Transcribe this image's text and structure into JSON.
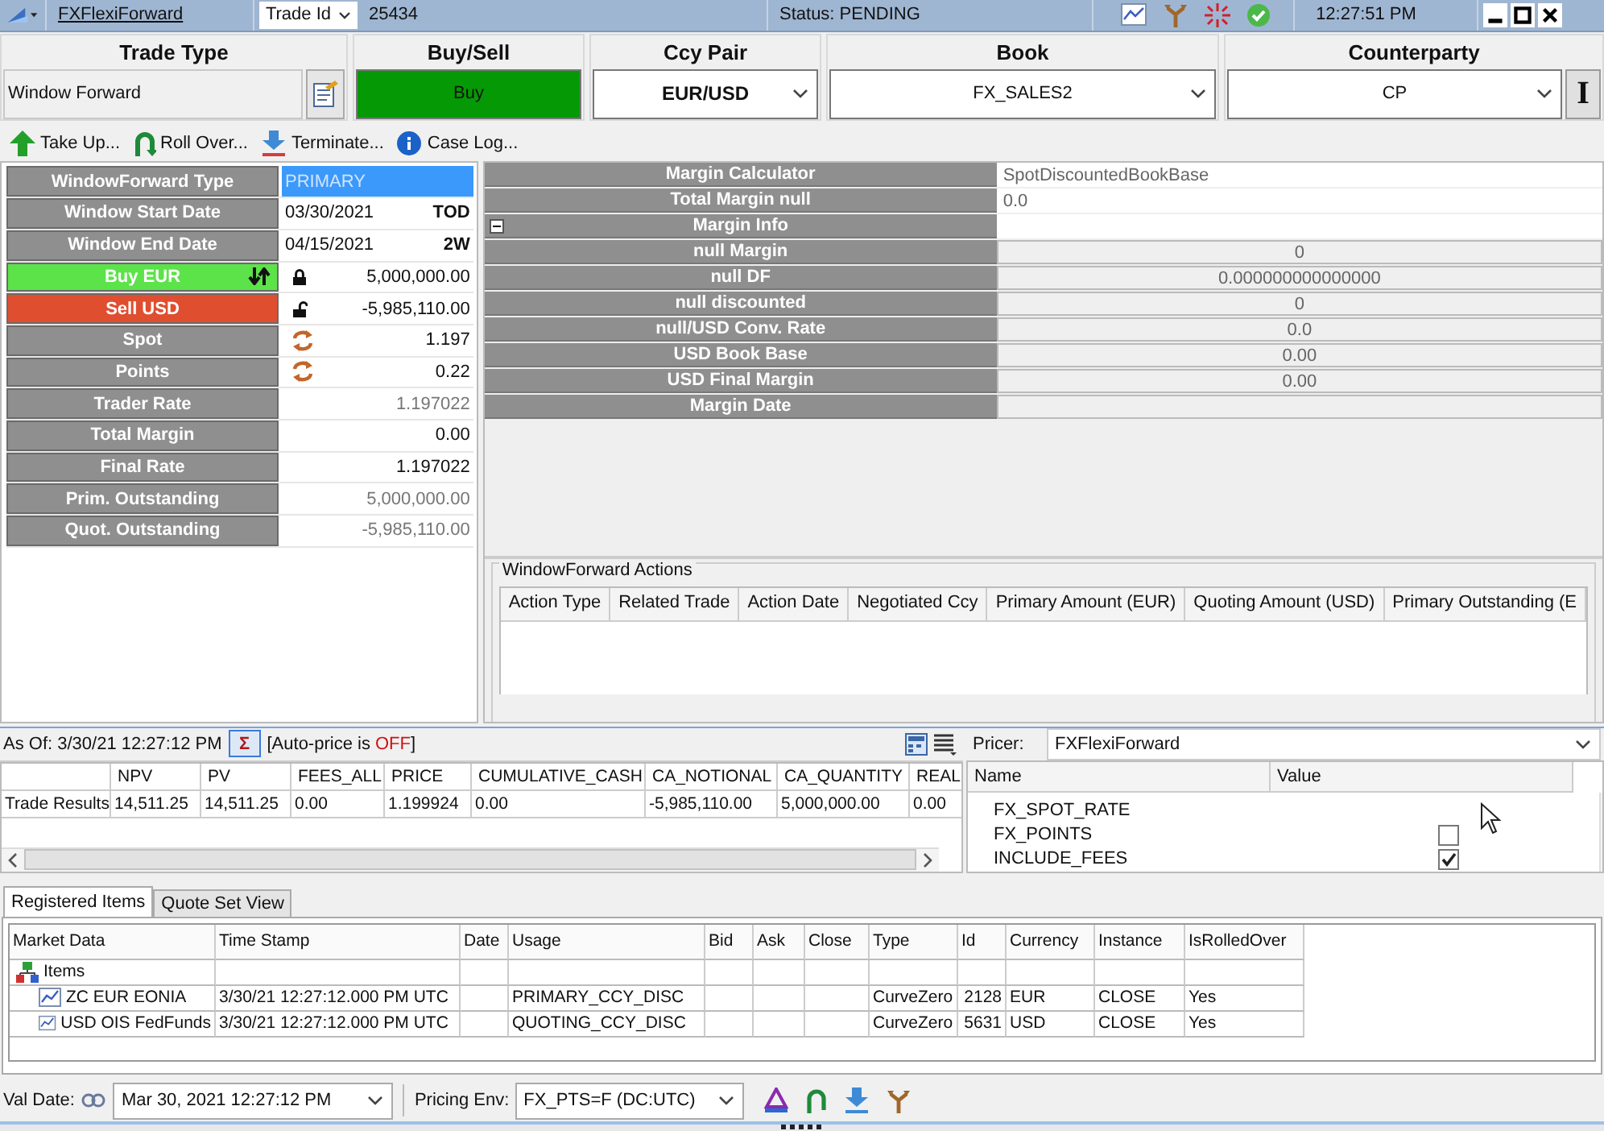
{
  "title_bar": {
    "trade_link": "FXFlexiForward",
    "id_selector": "Trade Id",
    "trade_id": "25434",
    "status": "Status: PENDING",
    "time": "12:27:51 PM"
  },
  "header_fields": [
    {
      "kind": "text",
      "label": "Trade Type",
      "value": "Window Forward"
    },
    {
      "kind": "buy",
      "label": "Buy/Sell",
      "value": "Buy"
    },
    {
      "kind": "select",
      "label": "Ccy Pair",
      "value": "EUR/USD"
    },
    {
      "kind": "select",
      "label": "Book",
      "value": "FX_SALES2"
    },
    {
      "kind": "select_button",
      "label": "Counterparty",
      "value": "CP",
      "button": "I"
    }
  ],
  "actions": [
    {
      "kind": "up",
      "label": "Take Up..."
    },
    {
      "kind": "roll",
      "label": "Roll Over..."
    },
    {
      "kind": "terminate",
      "label": "Terminate..."
    },
    {
      "kind": "info",
      "label": "Case Log..."
    }
  ],
  "trade_fields": [
    {
      "kind": "type",
      "label": "WindowForward Type",
      "value": "PRIMARY",
      "disabled": true
    },
    {
      "kind": "date",
      "label": "Window Start Date",
      "value": "03/30/2021",
      "tenor": "TOD",
      "disabled": false
    },
    {
      "kind": "date",
      "label": "Window End Date",
      "value": "04/15/2021",
      "tenor": "2W",
      "disabled": false
    },
    {
      "kind": "buy",
      "label": "Buy EUR",
      "value": "5,000,000.00",
      "locked": true,
      "disabled": false
    },
    {
      "kind": "sell",
      "label": "Sell USD",
      "value": "-5,985,110.00",
      "locked": false,
      "disabled": false
    },
    {
      "kind": "refresh",
      "label": "Spot",
      "value": "1.197",
      "disabled": false
    },
    {
      "kind": "refresh",
      "label": "Points",
      "value": "0.22",
      "disabled": false
    },
    {
      "kind": "plain",
      "label": "Trader Rate",
      "value": "1.197022",
      "disabled": true
    },
    {
      "kind": "plain",
      "label": "Total Margin",
      "value": "0.00",
      "disabled": false
    },
    {
      "kind": "plain",
      "label": "Final Rate",
      "value": "1.197022",
      "disabled": false
    },
    {
      "kind": "plain",
      "label": "Prim. Outstanding",
      "value": "5,000,000.00",
      "disabled": true
    },
    {
      "kind": "plain",
      "label": "Quot. Outstanding",
      "value": "-5,985,110.00",
      "disabled": true
    }
  ],
  "margin": [
    {
      "label": "Margin Calculator",
      "value": "SpotDiscountedBookBase"
    },
    {
      "label": "Total Margin null",
      "value": "0.0"
    },
    {
      "label": "Margin Info",
      "expanded": true,
      "children": [
        {
          "label": "null Margin",
          "value": "0"
        },
        {
          "label": "null DF",
          "value": "0.000000000000000"
        },
        {
          "label": "null discounted",
          "value": "0"
        },
        {
          "label": "null/USD Conv. Rate",
          "value": "0.0"
        },
        {
          "label": "USD Book Base",
          "value": "0.00"
        },
        {
          "label": "USD Final Margin",
          "value": "0.00"
        },
        {
          "label": "Margin Date"
        }
      ]
    }
  ],
  "actions_table": {
    "title": "WindowForward Actions",
    "columns": [
      "Action Type",
      "Related Trade",
      "Action Date",
      "Negotiated Ccy",
      "Primary Amount (EUR)",
      "Quoting Amount (USD)",
      "Primary Outstanding (E"
    ]
  },
  "as_of": {
    "label": "As Of: 3/30/21 12:27:12 PM",
    "sum_button": "Σ",
    "auto_price_before": "[Auto-price is",
    "auto_price_on": false,
    "auto_price_state": "OFF",
    "auto_price_after": "]"
  },
  "results": {
    "columns": [
      "NPV",
      "PV",
      "FEES_ALL",
      "PRICE",
      "CUMULATIVE_CASH",
      "CA_NOTIONAL",
      "CA_QUANTITY",
      "REAL"
    ],
    "rows": [
      {
        "label": "Trade Results",
        "cells": [
          "14,511.25",
          "14,511.25",
          "0.00",
          "1.199924",
          "0.00",
          "-5,985,110.00",
          "5,000,000.00",
          "0.00"
        ]
      }
    ]
  },
  "pricer": {
    "label": "Pricer:",
    "value": "FXFlexiForward",
    "columns": [
      "Name",
      "Value"
    ],
    "rows": [
      {
        "kind": "blank",
        "name": "FX_SPOT_RATE"
      },
      {
        "kind": "checkbox",
        "name": "FX_POINTS",
        "checked": false
      },
      {
        "kind": "checkbox",
        "name": "INCLUDE_FEES",
        "checked": true
      }
    ]
  },
  "tabs": [
    {
      "label": "Registered Items",
      "selected": true
    },
    {
      "label": "Quote Set View",
      "selected": false
    }
  ],
  "market": {
    "columns": [
      "Market Data",
      "Time Stamp",
      "Date",
      "Usage",
      "Bid",
      "Ask",
      "Close",
      "Type",
      "Id",
      "Currency",
      "Instance",
      "IsRolledOver"
    ],
    "root": {
      "label": "Items",
      "children": [
        {
          "label": "ZC EUR EONIA",
          "cells": [
            "3/30/21 12:27:12.000 PM UTC",
            "",
            "PRIMARY_CCY_DISC",
            "",
            "",
            "",
            "CurveZero",
            "2128",
            "EUR",
            "CLOSE",
            "Yes"
          ]
        },
        {
          "label": "USD OIS FedFunds",
          "cells": [
            "3/30/21 12:27:12.000 PM UTC",
            "",
            "QUOTING_CCY_DISC",
            "",
            "",
            "",
            "CurveZero",
            "5631",
            "USD",
            "CLOSE",
            "Yes"
          ]
        }
      ]
    }
  },
  "footer": {
    "val_date_label": "Val Date:",
    "val_date": "Mar 30, 2021 12:27:12 PM",
    "env_label": "Pricing Env:",
    "env": "FX_PTS=F (DC:UTC)"
  }
}
